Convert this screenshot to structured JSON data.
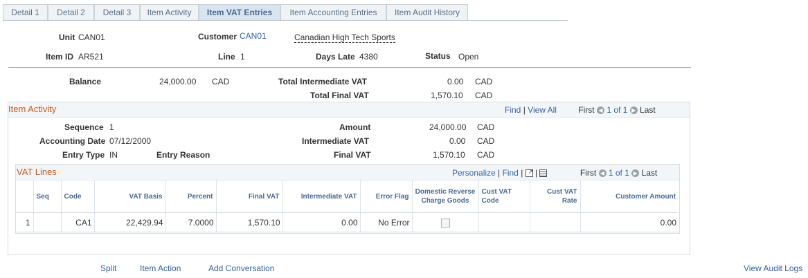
{
  "tabs": [
    {
      "label": "Detail 1"
    },
    {
      "label": "Detail 2"
    },
    {
      "label": "Detail 3"
    },
    {
      "label": "Item Activity"
    },
    {
      "label": "Item VAT Entries"
    },
    {
      "label": "Item Accounting Entries"
    },
    {
      "label": "Item Audit History"
    }
  ],
  "header": {
    "unit_label": "Unit",
    "unit_value": "CAN01",
    "customer_label": "Customer",
    "customer_value": "CAN01",
    "customer_name": "Canadian High Tech Sports",
    "item_id_label": "Item ID",
    "item_id_value": "AR521",
    "line_label": "Line",
    "line_value": "1",
    "days_late_label": "Days Late",
    "days_late_value": "4380",
    "status_label": "Status",
    "status_value": "Open"
  },
  "summary": {
    "balance_label": "Balance",
    "balance_value": "24,000.00",
    "balance_currency": "CAD",
    "total_intermediate_vat_label": "Total Intermediate VAT",
    "total_intermediate_vat_value": "0.00",
    "total_intermediate_vat_currency": "CAD",
    "total_final_vat_label": "Total Final VAT",
    "total_final_vat_value": "1,570.10",
    "total_final_vat_currency": "CAD"
  },
  "item_activity": {
    "title": "Item Activity",
    "nav": {
      "find": "Find",
      "sep": "|",
      "view_all": "View All",
      "first": "First",
      "range": "1 of 1",
      "last": "Last"
    },
    "sequence_label": "Sequence",
    "sequence_value": "1",
    "accounting_date_label": "Accounting Date",
    "accounting_date_value": "07/12/2000",
    "entry_type_label": "Entry Type",
    "entry_type_value": "IN",
    "entry_reason_label": "Entry Reason",
    "amount_label": "Amount",
    "amount_value": "24,000.00",
    "amount_currency": "CAD",
    "intermediate_vat_label": "Intermediate VAT",
    "intermediate_vat_value": "0.00",
    "intermediate_vat_currency": "CAD",
    "final_vat_label": "Final VAT",
    "final_vat_value": "1,570.10",
    "final_vat_currency": "CAD"
  },
  "vat_lines": {
    "title": "VAT Lines",
    "nav": {
      "personalize": "Personalize",
      "sep": "|",
      "find": "Find",
      "first": "First",
      "range": "1 of 1",
      "last": "Last"
    },
    "columns": [
      "Seq",
      "Code",
      "VAT Basis",
      "Percent",
      "Final VAT",
      "Intermediate VAT",
      "Error Flag",
      "Domestic Reverse Charge Goods",
      "Cust VAT Code",
      "Cust VAT Rate",
      "Customer Amount"
    ],
    "rows": [
      {
        "row_num": "1",
        "seq": "",
        "code": "CA1",
        "vat_basis": "22,429.94",
        "percent": "7.0000",
        "final_vat": "1,570.10",
        "intermediate_vat": "0.00",
        "error_flag": "No Error",
        "cust_vat_code": "",
        "cust_vat_rate": "",
        "customer_amount": "0.00"
      }
    ]
  },
  "footer": {
    "split": "Split",
    "item_action": "Item Action",
    "add_conversation": "Add Conversation",
    "view_audit_logs": "View Audit Logs"
  },
  "icons": [
    "arrow-left-icon",
    "arrow-right-icon",
    "new-window-icon",
    "grid-download-icon"
  ],
  "colors": {
    "link": "#3363a3",
    "group_title": "#c05c22",
    "active_tab_bg": "#d9e4f1"
  }
}
